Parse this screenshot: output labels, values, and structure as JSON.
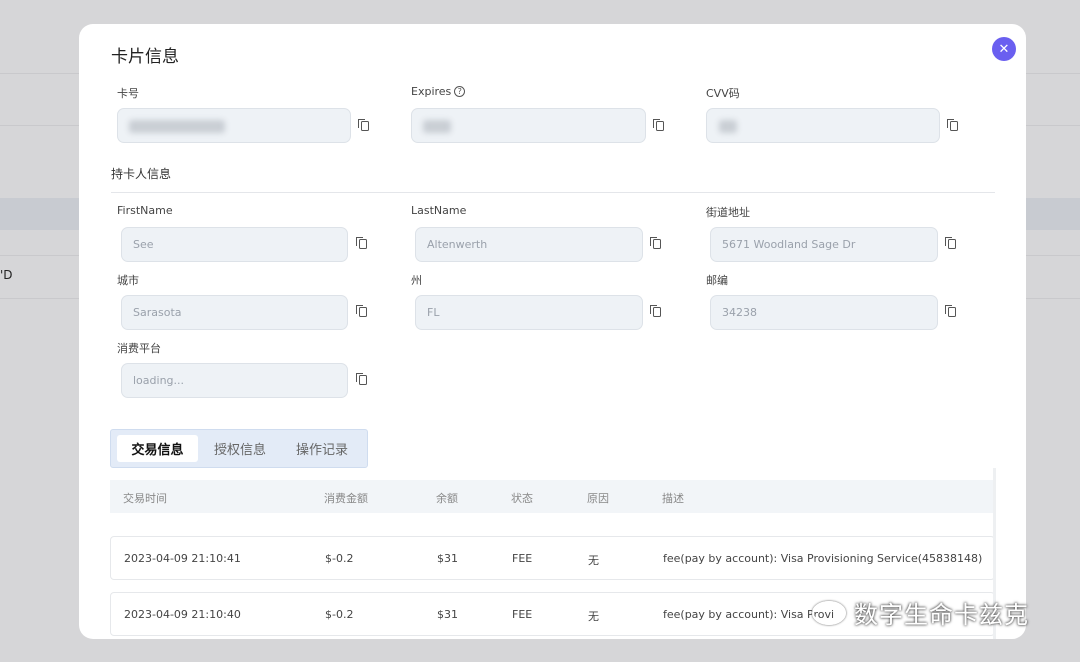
{
  "modal": {
    "title": "卡片信息",
    "close_glyph": "✕"
  },
  "card": {
    "number_label": "卡号",
    "expires_label": "Expires",
    "cvv_label": "CVV码"
  },
  "holder": {
    "section_title": "持卡人信息",
    "first_name_label": "FirstName",
    "first_name_value": "See",
    "last_name_label": "LastName",
    "last_name_value": "Altenwerth",
    "street_label": "街道地址",
    "street_value": "5671 Woodland Sage Dr",
    "city_label": "城市",
    "city_value": "Sarasota",
    "state_label": "州",
    "state_value": "FL",
    "zip_label": "邮编",
    "zip_value": "34238",
    "platform_label": "消费平台",
    "platform_value": "loading..."
  },
  "tabs": [
    {
      "label": "交易信息",
      "active": true
    },
    {
      "label": "授权信息",
      "active": false
    },
    {
      "label": "操作记录",
      "active": false
    }
  ],
  "table": {
    "headers": [
      "交易时间",
      "消费金额",
      "余额",
      "状态",
      "原因",
      "描述"
    ],
    "rows": [
      [
        "2023-04-09 21:10:41",
        "$-0.2",
        "$31",
        "FEE",
        "无",
        "fee(pay by account): Visa Provisioning Service(45838148)"
      ],
      [
        "2023-04-09 21:10:40",
        "$-0.2",
        "$31",
        "FEE",
        "无",
        "fee(pay by account): Visa Provi"
      ]
    ]
  },
  "background": {
    "partial_text": "'D"
  },
  "watermark": {
    "text": "数字生命卡兹克"
  },
  "colors": {
    "accent": "#6a5ff0",
    "input_bg": "#eef2f6",
    "tab_bar_bg": "#e3ebf7"
  }
}
